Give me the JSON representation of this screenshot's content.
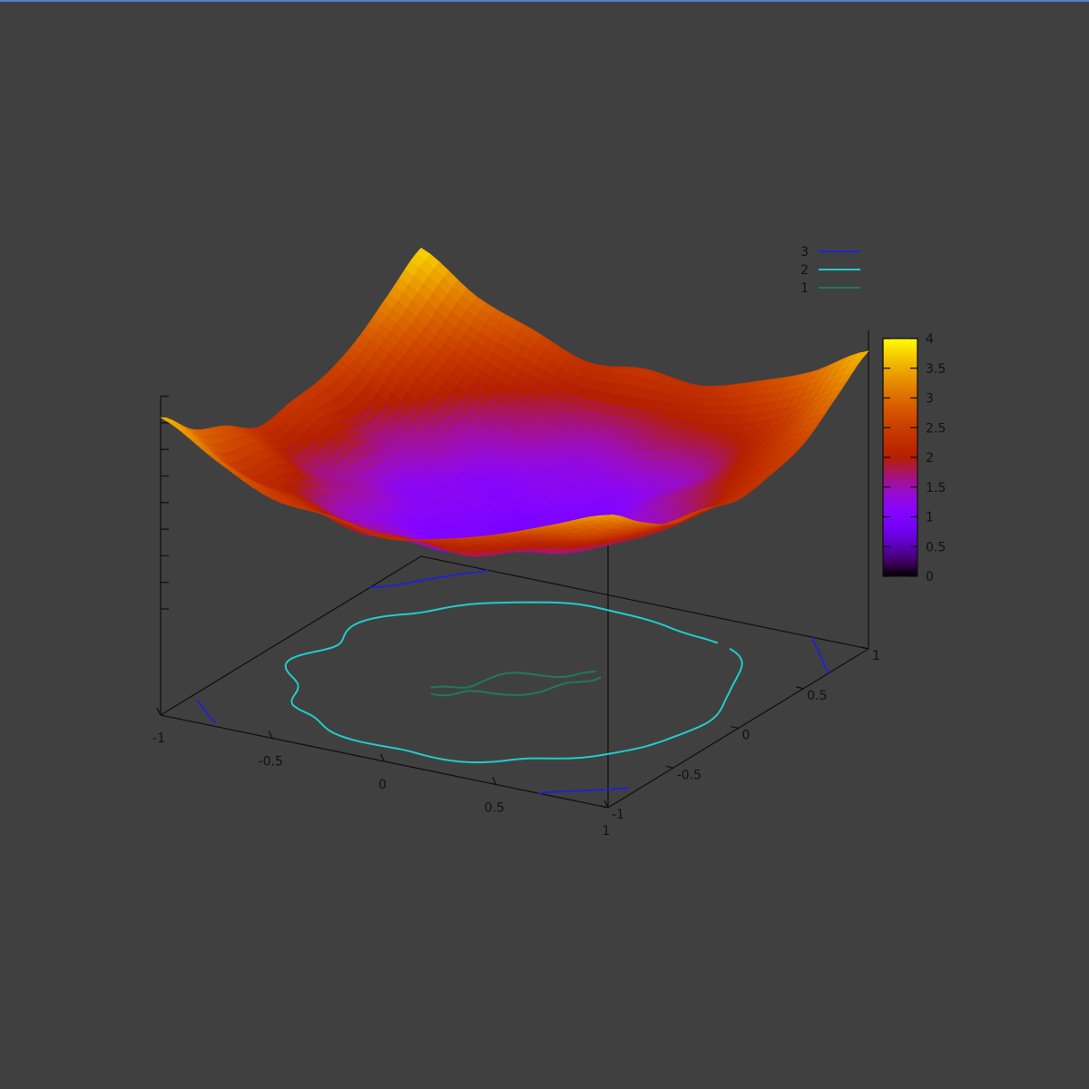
{
  "chart_data": {
    "type": "surface",
    "title": "",
    "x": [
      -1,
      -0.75,
      -0.5,
      -0.25,
      0,
      0.25,
      0.5,
      0.75,
      1
    ],
    "y": [
      -1,
      -0.75,
      -0.5,
      -0.25,
      0,
      0.25,
      0.5,
      0.75,
      1
    ],
    "z_grid_rows_by_x": [
      [
        3.6,
        3.0,
        2.7,
        2.3,
        2.4,
        2.5,
        2.8,
        3.3,
        3.8
      ],
      [
        3.0,
        2.3,
        2.2,
        1.7,
        1.9,
        1.7,
        2.2,
        2.6,
        3.1
      ],
      [
        2.5,
        2.1,
        1.5,
        1.5,
        1.2,
        1.5,
        1.6,
        2.1,
        2.7
      ],
      [
        2.4,
        1.7,
        1.4,
        1.0,
        1.2,
        1.1,
        1.5,
        1.8,
        2.3
      ],
      [
        2.2,
        1.8,
        1.2,
        1.1,
        0.9,
        1.2,
        1.3,
        1.7,
        2.4
      ],
      [
        2.4,
        1.7,
        1.5,
        1.2,
        1.1,
        1.0,
        1.4,
        1.9,
        2.3
      ],
      [
        2.7,
        2.2,
        1.6,
        1.4,
        1.3,
        1.5,
        1.5,
        2.0,
        2.6
      ],
      [
        3.1,
        2.5,
        2.1,
        1.8,
        1.7,
        1.9,
        2.1,
        2.4,
        3.0
      ],
      [
        3.5,
        3.0,
        2.6,
        2.5,
        2.3,
        2.4,
        2.6,
        3.1,
        3.6
      ]
    ],
    "xlim": [
      -1,
      1
    ],
    "ylim": [
      -1,
      1
    ],
    "zlim": [
      0,
      4
    ],
    "x_ticks": [
      "-1",
      "-0.5",
      "0",
      "0.5",
      "1"
    ],
    "y_ticks": [
      "-1",
      "-0.5",
      "0",
      "0.5",
      "1"
    ],
    "z_tick_values": [
      0,
      0.5,
      1,
      1.5,
      2,
      2.5,
      3,
      3.5,
      4
    ],
    "colorbar": {
      "range": [
        0,
        4
      ],
      "ticks": [
        "0",
        "0.5",
        "1",
        "1.5",
        "2",
        "2.5",
        "3",
        "3.5",
        "4"
      ],
      "palette": "rgbformulae 7,5,15"
    },
    "contours": [
      {
        "level": 3,
        "label": "3",
        "color": "#2222cc"
      },
      {
        "level": 2,
        "label": "2",
        "color": "#22cccc"
      },
      {
        "level": 1,
        "label": "1",
        "color": "#1f7a5c"
      }
    ],
    "legend_position": "top-right",
    "colors": {
      "background": "#404040",
      "axis": "#111111",
      "frame_top": "#5a7fc7"
    }
  }
}
